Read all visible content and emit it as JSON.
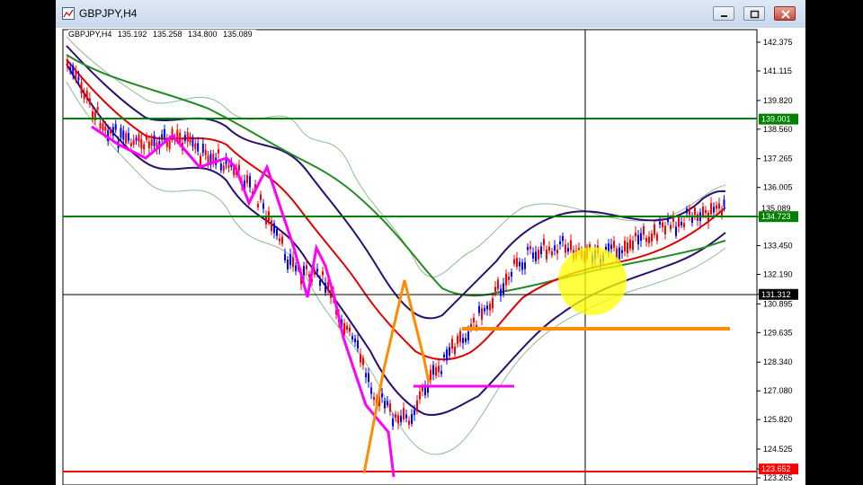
{
  "window": {
    "title": "GBPJPY,H4",
    "icon": "chart-window-icon",
    "controls": [
      "minimize-icon",
      "maximize-icon",
      "close-icon"
    ]
  },
  "chart": {
    "symbol": "GBPJPY,H4",
    "open": "135.192",
    "high": "135.258",
    "low": "134.800",
    "close": "135.089",
    "price_ticks": [
      "142.375",
      "141.115",
      "139.820",
      "138.560",
      "137.265",
      "136.005",
      "134.723",
      "133.450",
      "132.190",
      "131.312",
      "130.895",
      "129.635",
      "128.340",
      "127.080",
      "125.820",
      "124.525",
      "123.652",
      "123.265"
    ],
    "price_labels": {
      "current": "135.089",
      "h1": "139.001",
      "h2": "134.723",
      "h3": "131.312",
      "h4": "123.652"
    },
    "colors": {
      "bull_candle": "#0000ff",
      "bear_candle": "#ff0000",
      "ma_fast": "#e00000",
      "ma_slow": "#228b22",
      "bands_inner": "#2b0f6e",
      "bands_outer": "#8fbc8f",
      "level_green": "#008000",
      "level_red": "#ff0000",
      "zigzag": "#ff00ff",
      "zigzag2": "#ff8c00",
      "highlight": "#ffff00"
    }
  }
}
